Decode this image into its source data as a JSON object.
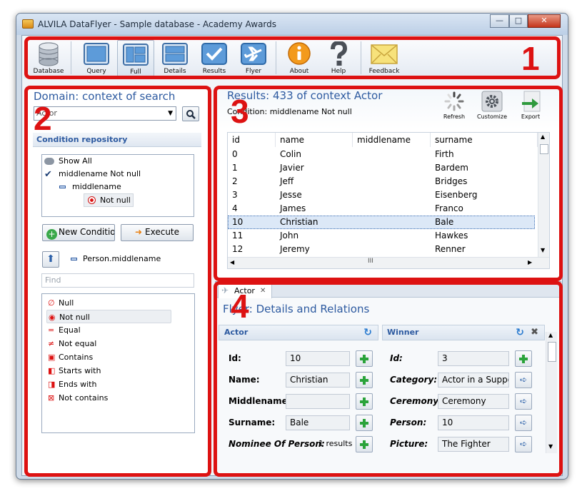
{
  "window": {
    "title": "ALVILA DataFlyer - Sample database - Academy Awards",
    "min": "—",
    "max": "□",
    "close": "✕"
  },
  "toolbar": {
    "items": [
      "Database",
      "Query",
      "Full",
      "Details",
      "Results",
      "Flyer",
      "About",
      "Help",
      "Feedback"
    ],
    "selected": "Full"
  },
  "callouts": [
    "1",
    "2",
    "3",
    "4"
  ],
  "domain": {
    "title": "Domain: context of search",
    "selected": "Actor"
  },
  "conditions": {
    "repo_title": "Condition repository",
    "tree": [
      "Show All",
      "middlename Not null",
      "middlename",
      "Not null"
    ],
    "new_button": "New Conditio",
    "execute_button": "Execute",
    "path": "Person.middlename",
    "find_placeholder": "Find",
    "operators": [
      "Null",
      "Not null",
      "Equal",
      "Not equal",
      "Contains",
      "Starts with",
      "Ends with",
      "Not contains"
    ],
    "operator_selected": "Not null"
  },
  "results": {
    "title": "Results: 433 of context Actor",
    "condition": "Condition: middlename Not null",
    "actions": [
      "Refresh",
      "Customize",
      "Export"
    ],
    "columns": [
      "id",
      "name",
      "middlename",
      "surname"
    ],
    "rows": [
      [
        "0",
        "Colin",
        "",
        "Firth"
      ],
      [
        "1",
        "Javier",
        "",
        "Bardem"
      ],
      [
        "2",
        "Jeff",
        "",
        "Bridges"
      ],
      [
        "3",
        "Jesse",
        "",
        "Eisenberg"
      ],
      [
        "4",
        "James",
        "",
        "Franco"
      ],
      [
        "10",
        "Christian",
        "",
        "Bale"
      ],
      [
        "11",
        "John",
        "",
        "Hawkes"
      ],
      [
        "12",
        "Jeremy",
        "",
        "Renner"
      ]
    ],
    "selected_row": "10",
    "hscroll": "III"
  },
  "flyer": {
    "tab": "Actor",
    "title": "Flyer: Details and Relations",
    "actor": {
      "header": "Actor",
      "fields": [
        {
          "label": "Id:",
          "value": "10"
        },
        {
          "label": "Name:",
          "value": "Christian"
        },
        {
          "label": "Middlename:",
          "value": ""
        },
        {
          "label": "Surname:",
          "value": "Bale"
        },
        {
          "label": "Nominee Of Person:",
          "value": "1 results"
        }
      ]
    },
    "winner": {
      "header": "Winner",
      "fields": [
        {
          "label": "Id:",
          "value": "3"
        },
        {
          "label": "Category:",
          "value": "Actor in a Suppor"
        },
        {
          "label": "Ceremony:",
          "value": "Ceremony"
        },
        {
          "label": "Person:",
          "value": "10"
        },
        {
          "label": "Picture:",
          "value": "The Fighter"
        }
      ]
    }
  },
  "colors": {
    "callout": "#dd1212",
    "accent": "#2d5aa0",
    "selection": "#dce8f7"
  }
}
